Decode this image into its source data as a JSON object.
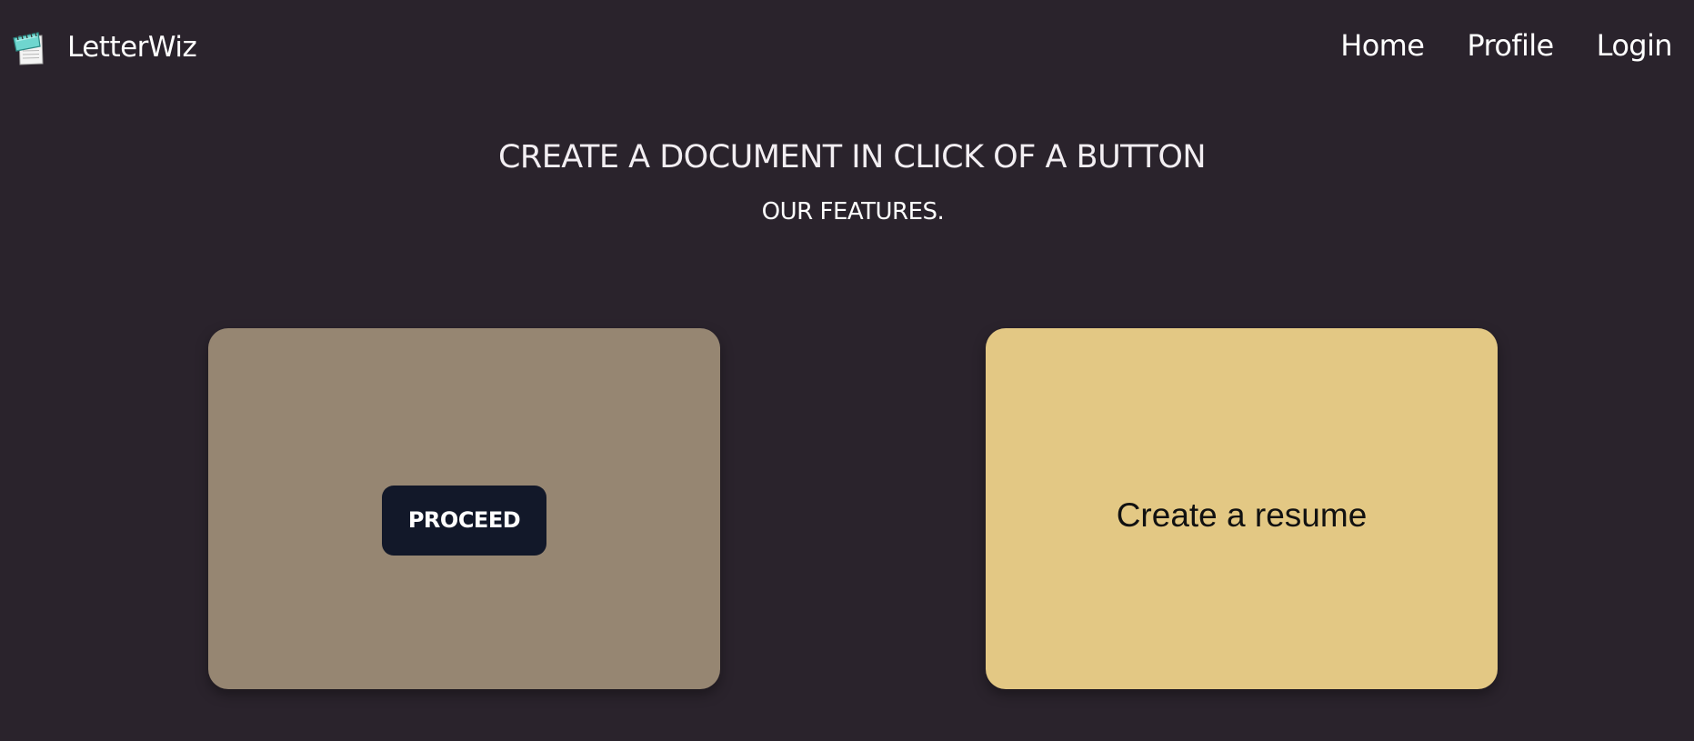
{
  "navbar": {
    "brand_name": "LetterWiz",
    "logo_icon": "notepad-icon",
    "links": [
      {
        "label": "Home"
      },
      {
        "label": "Profile"
      },
      {
        "label": "Login"
      }
    ]
  },
  "hero": {
    "title": "CREATE A DOCUMENT IN CLICK OF A BUTTON",
    "subtitle": "OUR FEATURES."
  },
  "cards": [
    {
      "button_label": "PROCEED",
      "color": "#968672",
      "button_color": "#121829"
    },
    {
      "label": "Create a resume",
      "color": "#e3c884"
    }
  ],
  "colors": {
    "background": "#2a232c",
    "text": "#ffffff"
  }
}
